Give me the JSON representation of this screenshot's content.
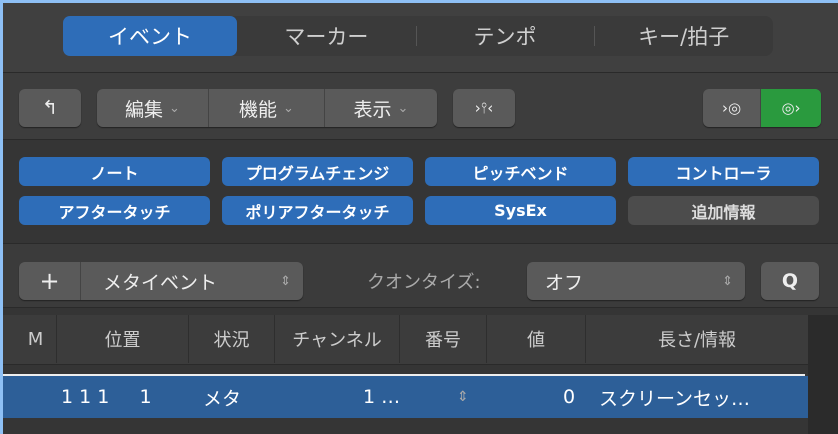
{
  "tabs": [
    {
      "label": "イベント",
      "active": true
    },
    {
      "label": "マーカー"
    },
    {
      "label": "テンポ"
    },
    {
      "label": "キー/拍子"
    }
  ],
  "toolbar": {
    "up_icon": "up-arrow-icon",
    "menus": [
      "編集",
      "機能",
      "表示"
    ],
    "chevron": "⌄",
    "capture_icon": "catch-playhead-icon",
    "midi_in_icon": "midi-in-icon",
    "midi_out_icon": "midi-out-icon",
    "midi_out_color": "#2a9a3e"
  },
  "filters": [
    {
      "label": "ノート",
      "on": true
    },
    {
      "label": "プログラムチェンジ",
      "on": true
    },
    {
      "label": "ピッチベンド",
      "on": true
    },
    {
      "label": "コントローラ",
      "on": true
    },
    {
      "label": "アフタータッチ",
      "on": true
    },
    {
      "label": "ポリアフタータッチ",
      "on": true
    },
    {
      "label": "SysEx",
      "on": true
    },
    {
      "label": "追加情報",
      "on": false
    }
  ],
  "create": {
    "plus": "+",
    "type": "メタイベント"
  },
  "quantize": {
    "label": "クオンタイズ:",
    "value": "オフ",
    "q_button": "Q"
  },
  "columns": [
    "M",
    "位置",
    "状況",
    "チャンネル",
    "番号",
    "値",
    "長さ/情報"
  ],
  "rows": [
    {
      "m": "",
      "position": "1 1 1     1",
      "status": "メタ",
      "channel": "",
      "number": "1 …",
      "value": "0",
      "info": "スクリーンセッ…"
    }
  ],
  "colors": {
    "accent": "#2e6db8",
    "selection": "#2d5f98"
  }
}
